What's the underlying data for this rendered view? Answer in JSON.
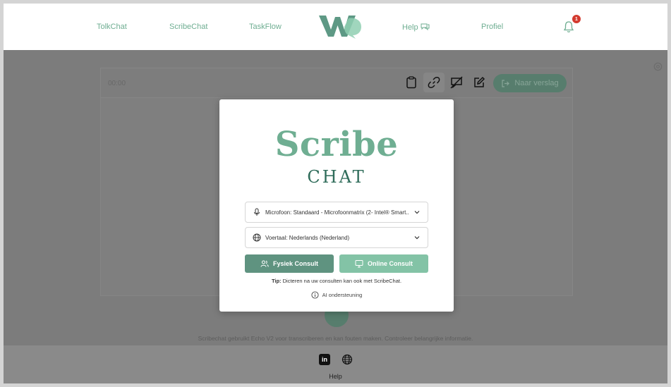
{
  "nav": {
    "items": [
      "TolkChat",
      "ScribeChat",
      "TaskFlow",
      "Help",
      "Profiel"
    ],
    "notification_count": "1"
  },
  "editor": {
    "timer": "00:00",
    "naar_verslag_label": "Naar verslag"
  },
  "modal": {
    "brand_title": "Scribe",
    "brand_subtitle": "CHAT",
    "microphone_select": "Microfoon: Standaard - Microfoonmatrix (2- Intel® Smart...",
    "language_select": "Voertaal: Nederlands (Nederland)",
    "fysiek_button": "Fysiek Consult",
    "online_button": "Online Consult",
    "tip_label": "Tip:",
    "tip_text": " Dicteren na uw consulten kan ook met ScribeChat.",
    "ai_label": "AI ondersteuning"
  },
  "footer": {
    "disclaimer": "Scribechat gebruikt Echo V2 voor transcriberen en kan fouten maken. Controleer belangrijke informatie.",
    "linkedin": "in",
    "help": "Help"
  },
  "colors": {
    "brand_green": "#6fae92",
    "brand_dark_green": "#2f6c5a",
    "fysiek_button": "#5f9380",
    "online_button": "#83c3a6",
    "badge_red": "#d33b2f"
  },
  "icons": [
    "logo-icon",
    "help-chat-icon",
    "bell-icon",
    "gear-icon",
    "clipboard-icon",
    "link-icon",
    "chat-off-icon",
    "edit-icon",
    "exit-icon",
    "microphone-icon",
    "globe-icon",
    "chevron-down-icon",
    "users-icon",
    "monitor-icon",
    "info-icon",
    "linkedin-icon"
  ]
}
